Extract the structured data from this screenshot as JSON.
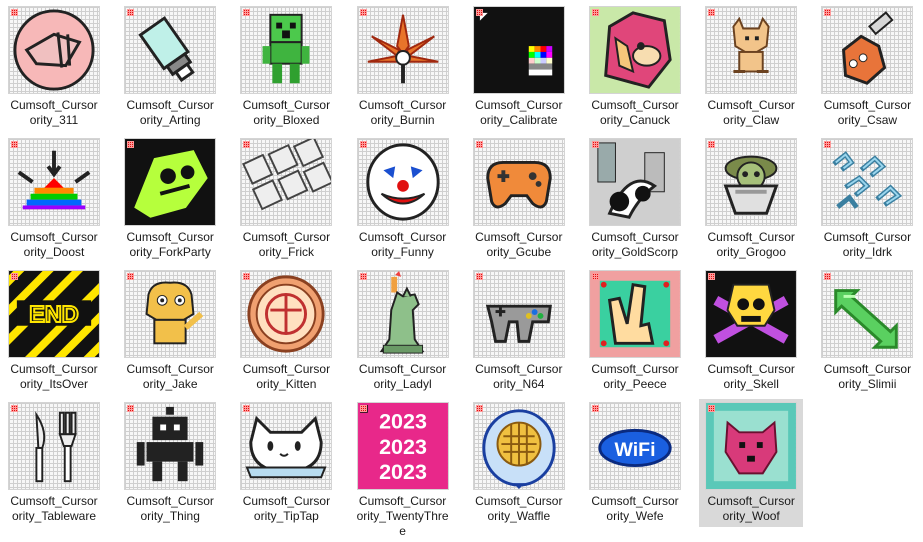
{
  "window": {
    "view": "large-icons"
  },
  "colors": {
    "selection": "#d9d9d9",
    "badge": "#e01010"
  },
  "files": [
    {
      "line1": "Cumsoft_Cursor",
      "line2": "ority_311",
      "icon": "cursor-311-icon",
      "selected": false
    },
    {
      "line1": "Cumsoft_Cursor",
      "line2": "ority_Arting",
      "icon": "paint-tube-icon",
      "selected": false
    },
    {
      "line1": "Cumsoft_Cursor",
      "line2": "ority_Bloxed",
      "icon": "creeper-icon",
      "selected": false
    },
    {
      "line1": "Cumsoft_Cursor",
      "line2": "ority_Burnin",
      "icon": "leaf-icon",
      "selected": false
    },
    {
      "line1": "Cumsoft_Cursor",
      "line2": "ority_Calibrate",
      "icon": "calibrate-icon",
      "selected": false
    },
    {
      "line1": "Cumsoft_Cursor",
      "line2": "ority_Canuck",
      "icon": "hedgehog-icon",
      "selected": false
    },
    {
      "line1": "Cumsoft_Cursor",
      "line2": "ority_Claw",
      "icon": "cat-icon",
      "selected": false
    },
    {
      "line1": "Cumsoft_Cursor",
      "line2": "ority_Csaw",
      "icon": "chainsaw-icon",
      "selected": false
    },
    {
      "line1": "Cumsoft_Cursor",
      "line2": "ority_Doost",
      "icon": "rainbow-pyramid-icon",
      "selected": false
    },
    {
      "line1": "Cumsoft_Cursor",
      "line2": "ority_ForkParty",
      "icon": "skull-fork-icon",
      "selected": false
    },
    {
      "line1": "Cumsoft_Cursor",
      "line2": "ority_Frick",
      "icon": "keyboard-icon",
      "selected": false
    },
    {
      "line1": "Cumsoft_Cursor",
      "line2": "ority_Funny",
      "icon": "clown-icon",
      "selected": false
    },
    {
      "line1": "Cumsoft_Cursor",
      "line2": "ority_Gcube",
      "icon": "gamepad-icon",
      "selected": false
    },
    {
      "line1": "Cumsoft_Cursor",
      "line2": "ority_GoldScorp",
      "icon": "city-icon",
      "selected": false
    },
    {
      "line1": "Cumsoft_Cursor",
      "line2": "ority_Grogoo",
      "icon": "baby-alien-icon",
      "selected": false
    },
    {
      "line1": "Cumsoft_Cursor",
      "line2": "ority_Idrk",
      "icon": "squiggle-icon",
      "selected": false
    },
    {
      "line1": "Cumsoft_Cursor",
      "line2": "ority_ItsOver",
      "icon": "end-sign-icon",
      "selected": false
    },
    {
      "line1": "Cumsoft_Cursor",
      "line2": "ority_Jake",
      "icon": "dog-icon",
      "selected": false
    },
    {
      "line1": "Cumsoft_Cursor",
      "line2": "ority_Kitten",
      "icon": "kitten-seal-icon",
      "selected": false
    },
    {
      "line1": "Cumsoft_Cursor",
      "line2": "ority_Ladyl",
      "icon": "liberty-icon",
      "selected": false
    },
    {
      "line1": "Cumsoft_Cursor",
      "line2": "ority_N64",
      "icon": "controller-icon",
      "selected": false
    },
    {
      "line1": "Cumsoft_Cursor",
      "line2": "ority_Peece",
      "icon": "peace-hand-icon",
      "selected": false
    },
    {
      "line1": "Cumsoft_Cursor",
      "line2": "ority_Skell",
      "icon": "skull-crossbones-icon",
      "selected": false
    },
    {
      "line1": "Cumsoft_Cursor",
      "line2": "ority_Slimii",
      "icon": "green-arrow-icon",
      "selected": false
    },
    {
      "line1": "Cumsoft_Cursor",
      "line2": "ority_Tableware",
      "icon": "knife-fork-icon",
      "selected": false
    },
    {
      "line1": "Cumsoft_Cursor",
      "line2": "ority_Thing",
      "icon": "robot-icon",
      "selected": false
    },
    {
      "line1": "Cumsoft_Cursor",
      "line2": "ority_TipTap",
      "icon": "bongo-cat-icon",
      "selected": false
    },
    {
      "line1": "Cumsoft_Cursor",
      "line2": "ority_TwentyThre",
      "line3": "e",
      "icon": "year-2023-icon",
      "selected": false
    },
    {
      "line1": "Cumsoft_Cursor",
      "line2": "ority_Waffle",
      "icon": "waffle-icon",
      "selected": false
    },
    {
      "line1": "Cumsoft_Cursor",
      "line2": "ority_Wefe",
      "icon": "wifi-icon",
      "selected": false
    },
    {
      "line1": "Cumsoft_Cursor",
      "line2": "ority_Woof",
      "icon": "wolf-icon",
      "selected": true
    }
  ]
}
